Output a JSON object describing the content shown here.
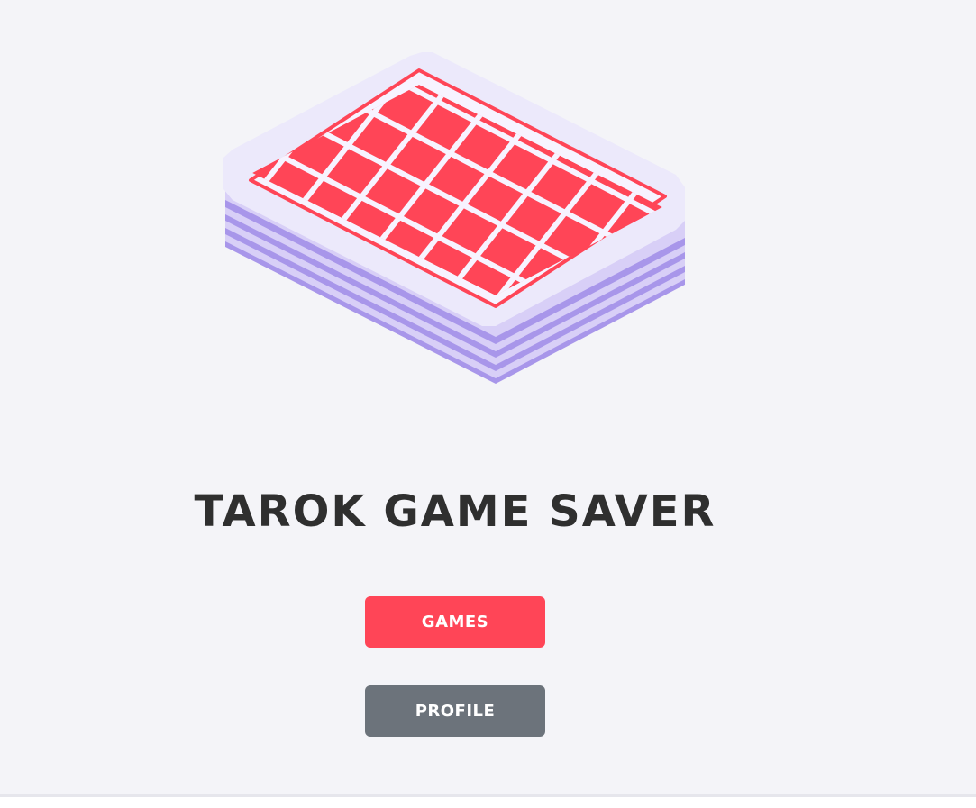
{
  "app": {
    "title": "TAROK GAME SAVER"
  },
  "hero": {
    "icon": "card-deck-icon"
  },
  "nav": {
    "games_label": "GAMES",
    "profile_label": "PROFILE"
  },
  "colors": {
    "background": "#f4f4f8",
    "accent": "#ff4557",
    "secondary": "#6c737b",
    "title": "#2f2f2f",
    "card_face": "#ece9fb",
    "card_edge": "#b6a6ee"
  }
}
